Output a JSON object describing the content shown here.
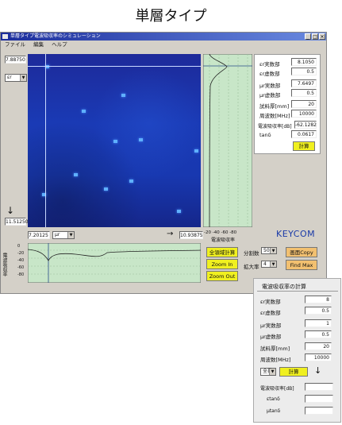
{
  "caption": "単層タイプ",
  "window": {
    "title": "単層タイプ電波吸収率のシミュレーション",
    "menu": [
      "ファイル",
      "編集",
      "ヘルプ"
    ]
  },
  "main": {
    "top_value": "7.88750",
    "bottom_value": "11.51250",
    "x_min": "7.20125",
    "x_max": "10.93875",
    "y_param": "εr",
    "x_param": "μr",
    "spectrum_xaxis": "-20 -40 -60 -80",
    "spectrum_label": "電波吸収率",
    "bottom_axis_label": "電波吸収率",
    "bottom_ticks": [
      "0",
      "-20",
      "-40",
      "-60",
      "-80"
    ]
  },
  "params": {
    "rows": [
      {
        "label": "εr実数部",
        "value": "8.1050"
      },
      {
        "label": "εr虚数部",
        "value": "0.5"
      },
      {
        "label": "μr実数部",
        "value": "7.6497"
      },
      {
        "label": "μr虚数部",
        "value": "0.5"
      },
      {
        "label": "試料厚[mm]",
        "value": "20"
      },
      {
        "label": "周波数[MHz]",
        "value": "10000"
      },
      {
        "label": "電波吸収率[dB]",
        "value": "-62.1282"
      },
      {
        "label": "tanδ",
        "value": "0.0617"
      }
    ],
    "calc_label": "計算"
  },
  "brand": "KEYCOM",
  "controls": {
    "sim_calc": "全領域計算",
    "zoom_in": "Zoom In",
    "zoom_out": "Zoom Out",
    "division_label": "分割数",
    "division_value": "50",
    "zoom_label": "拡大率",
    "zoom_value": "4",
    "copy_label": "画面Copy",
    "find_max_label": "Find Max"
  },
  "popup": {
    "title": "電波吸収率の計算",
    "rows": [
      {
        "label": "εr実数部",
        "value": "8"
      },
      {
        "label": "εr虚数部",
        "value": "0.5"
      },
      {
        "label": "μr実数部",
        "value": "1"
      },
      {
        "label": "μr虚数部",
        "value": "0.5"
      },
      {
        "label": "試料厚[mm]",
        "value": "20"
      },
      {
        "label": "周波数[MHz]",
        "value": "10000"
      }
    ],
    "select_value": "全界",
    "calc_label": "計算",
    "arrow": "↓",
    "results": [
      {
        "label": "電波吸収率[dB]",
        "value": ""
      },
      {
        "label": "εtanδ",
        "value": ""
      },
      {
        "label": "μtanδ",
        "value": ""
      }
    ]
  }
}
